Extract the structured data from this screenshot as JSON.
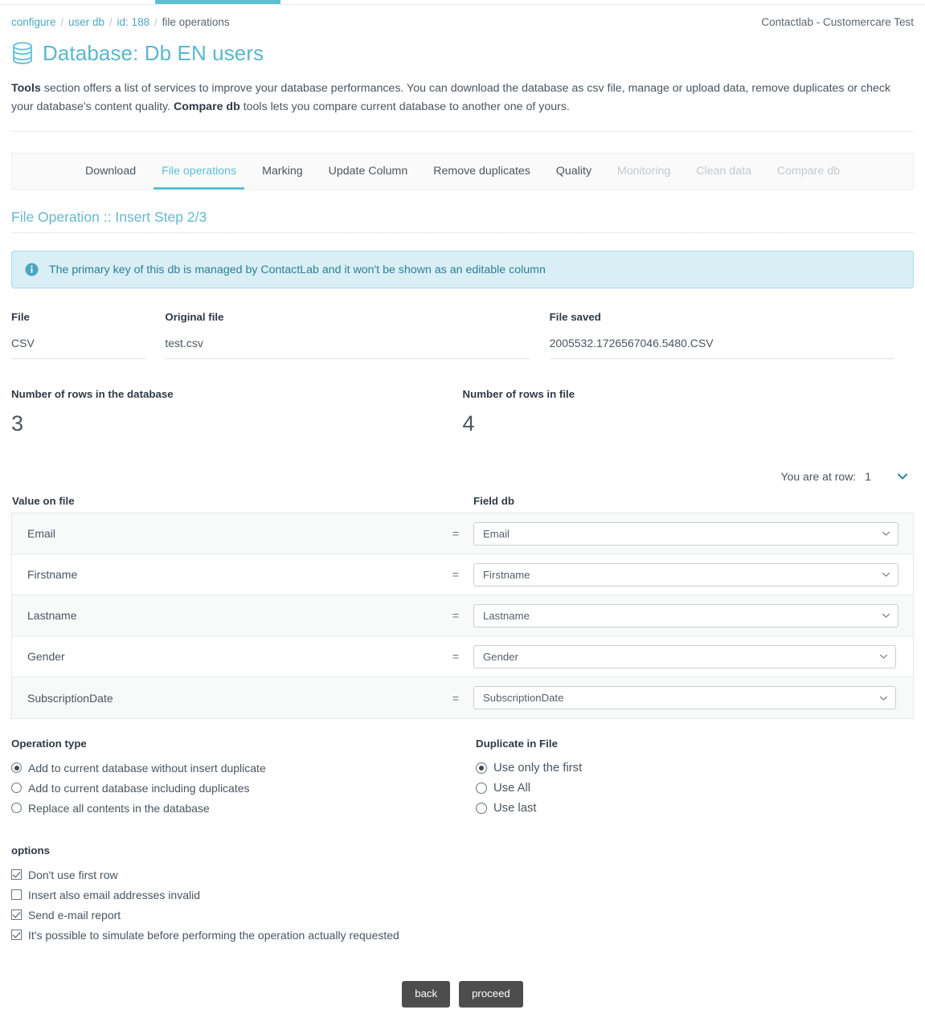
{
  "topbar": {
    "accent_color": "#5bc0d4"
  },
  "breadcrumb": {
    "items": [
      {
        "label": "configure",
        "link": true
      },
      {
        "label": "user db",
        "link": true
      },
      {
        "label": "id: 188",
        "link": true
      },
      {
        "label": "file operations",
        "link": false
      }
    ],
    "separator": "/"
  },
  "account": {
    "label": "Contactlab - Customercare Test"
  },
  "header": {
    "icon": "database-icon",
    "title": "Database: Db EN users",
    "title_color": "#59b7cd"
  },
  "intro": {
    "bold1": "Tools",
    "part1": " section offers a list of services to improve your database performances. You can download the database as csv file, manage or upload data, remove duplicates or check your database's content quality. ",
    "bold2": "Compare db",
    "part2": " tools lets you compare current database to another one of yours."
  },
  "tabs": [
    {
      "label": "Download",
      "state": "normal"
    },
    {
      "label": "File operations",
      "state": "active"
    },
    {
      "label": "Marking",
      "state": "normal"
    },
    {
      "label": "Update Column",
      "state": "normal"
    },
    {
      "label": "Remove duplicates",
      "state": "normal"
    },
    {
      "label": "Quality",
      "state": "normal"
    },
    {
      "label": "Monitoring",
      "state": "disabled"
    },
    {
      "label": "Clean data",
      "state": "disabled"
    },
    {
      "label": "Compare db",
      "state": "disabled"
    }
  ],
  "step": {
    "title": "File Operation :: Insert Step 2/3"
  },
  "alert": {
    "icon": "info-icon",
    "text": "The primary key of this db is managed by ContactLab and it won't be shown as an editable column",
    "bg_color": "#d9eff5",
    "text_color": "#2d7f96"
  },
  "file_info": [
    {
      "label": "File",
      "value": "CSV"
    },
    {
      "label": "Original file",
      "value": "test.csv"
    },
    {
      "label": "File saved",
      "value": "2005532.1726567046.5480.CSV"
    }
  ],
  "counts": [
    {
      "label": "Number of rows in the database",
      "value": "3"
    },
    {
      "label": "Number of rows in file",
      "value": "4"
    }
  ],
  "row_nav": {
    "label": "You are at row:",
    "value": "1",
    "caret_icon": "chevron-down-icon"
  },
  "mapping": {
    "col_file_header": "Value on file",
    "col_db_header": "Field db",
    "equals": "=",
    "rows": [
      {
        "file_value": "Email",
        "db_field": "Email"
      },
      {
        "file_value": "Firstname",
        "db_field": "Firstname"
      },
      {
        "file_value": "Lastname",
        "db_field": "Lastname"
      },
      {
        "file_value": "Gender",
        "db_field": "Gender"
      },
      {
        "file_value": "SubscriptionDate",
        "db_field": "SubscriptionDate"
      }
    ]
  },
  "operation_type": {
    "title": "Operation type",
    "options": [
      {
        "label": "Add to current database without insert duplicate",
        "selected": true
      },
      {
        "label": "Add to current database including duplicates",
        "selected": false
      },
      {
        "label": "Replace all contents in the database",
        "selected": false
      }
    ]
  },
  "duplicate_in_file": {
    "title": "Duplicate in File",
    "options": [
      {
        "label": "Use only the first",
        "selected": true
      },
      {
        "label": "Use All",
        "selected": false
      },
      {
        "label": "Use last",
        "selected": false
      }
    ]
  },
  "options": {
    "title": "options",
    "items": [
      {
        "label": "Don't use first row",
        "checked": true
      },
      {
        "label": "Insert also email addresses invalid",
        "checked": false
      },
      {
        "label": "Send e-mail report",
        "checked": true
      },
      {
        "label": "It's possible to simulate before performing the operation actually requested",
        "checked": true
      }
    ]
  },
  "footer": {
    "back_label": "back",
    "proceed_label": "proceed",
    "button_color": "#4d4d4d"
  }
}
